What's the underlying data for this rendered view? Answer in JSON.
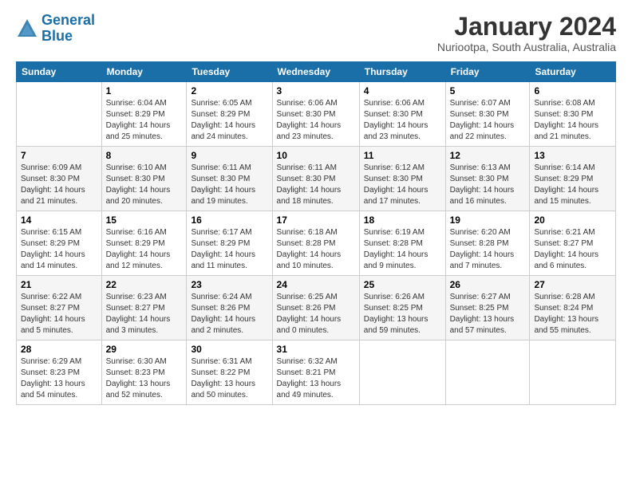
{
  "logo": {
    "line1": "General",
    "line2": "Blue"
  },
  "title": "January 2024",
  "subtitle": "Nuriootpa, South Australia, Australia",
  "days_header": [
    "Sunday",
    "Monday",
    "Tuesday",
    "Wednesday",
    "Thursday",
    "Friday",
    "Saturday"
  ],
  "weeks": [
    [
      {
        "num": "",
        "detail": ""
      },
      {
        "num": "1",
        "detail": "Sunrise: 6:04 AM\nSunset: 8:29 PM\nDaylight: 14 hours\nand 25 minutes."
      },
      {
        "num": "2",
        "detail": "Sunrise: 6:05 AM\nSunset: 8:29 PM\nDaylight: 14 hours\nand 24 minutes."
      },
      {
        "num": "3",
        "detail": "Sunrise: 6:06 AM\nSunset: 8:30 PM\nDaylight: 14 hours\nand 23 minutes."
      },
      {
        "num": "4",
        "detail": "Sunrise: 6:06 AM\nSunset: 8:30 PM\nDaylight: 14 hours\nand 23 minutes."
      },
      {
        "num": "5",
        "detail": "Sunrise: 6:07 AM\nSunset: 8:30 PM\nDaylight: 14 hours\nand 22 minutes."
      },
      {
        "num": "6",
        "detail": "Sunrise: 6:08 AM\nSunset: 8:30 PM\nDaylight: 14 hours\nand 21 minutes."
      }
    ],
    [
      {
        "num": "7",
        "detail": "Sunrise: 6:09 AM\nSunset: 8:30 PM\nDaylight: 14 hours\nand 21 minutes."
      },
      {
        "num": "8",
        "detail": "Sunrise: 6:10 AM\nSunset: 8:30 PM\nDaylight: 14 hours\nand 20 minutes."
      },
      {
        "num": "9",
        "detail": "Sunrise: 6:11 AM\nSunset: 8:30 PM\nDaylight: 14 hours\nand 19 minutes."
      },
      {
        "num": "10",
        "detail": "Sunrise: 6:11 AM\nSunset: 8:30 PM\nDaylight: 14 hours\nand 18 minutes."
      },
      {
        "num": "11",
        "detail": "Sunrise: 6:12 AM\nSunset: 8:30 PM\nDaylight: 14 hours\nand 17 minutes."
      },
      {
        "num": "12",
        "detail": "Sunrise: 6:13 AM\nSunset: 8:30 PM\nDaylight: 14 hours\nand 16 minutes."
      },
      {
        "num": "13",
        "detail": "Sunrise: 6:14 AM\nSunset: 8:29 PM\nDaylight: 14 hours\nand 15 minutes."
      }
    ],
    [
      {
        "num": "14",
        "detail": "Sunrise: 6:15 AM\nSunset: 8:29 PM\nDaylight: 14 hours\nand 14 minutes."
      },
      {
        "num": "15",
        "detail": "Sunrise: 6:16 AM\nSunset: 8:29 PM\nDaylight: 14 hours\nand 12 minutes."
      },
      {
        "num": "16",
        "detail": "Sunrise: 6:17 AM\nSunset: 8:29 PM\nDaylight: 14 hours\nand 11 minutes."
      },
      {
        "num": "17",
        "detail": "Sunrise: 6:18 AM\nSunset: 8:28 PM\nDaylight: 14 hours\nand 10 minutes."
      },
      {
        "num": "18",
        "detail": "Sunrise: 6:19 AM\nSunset: 8:28 PM\nDaylight: 14 hours\nand 9 minutes."
      },
      {
        "num": "19",
        "detail": "Sunrise: 6:20 AM\nSunset: 8:28 PM\nDaylight: 14 hours\nand 7 minutes."
      },
      {
        "num": "20",
        "detail": "Sunrise: 6:21 AM\nSunset: 8:27 PM\nDaylight: 14 hours\nand 6 minutes."
      }
    ],
    [
      {
        "num": "21",
        "detail": "Sunrise: 6:22 AM\nSunset: 8:27 PM\nDaylight: 14 hours\nand 5 minutes."
      },
      {
        "num": "22",
        "detail": "Sunrise: 6:23 AM\nSunset: 8:27 PM\nDaylight: 14 hours\nand 3 minutes."
      },
      {
        "num": "23",
        "detail": "Sunrise: 6:24 AM\nSunset: 8:26 PM\nDaylight: 14 hours\nand 2 minutes."
      },
      {
        "num": "24",
        "detail": "Sunrise: 6:25 AM\nSunset: 8:26 PM\nDaylight: 14 hours\nand 0 minutes."
      },
      {
        "num": "25",
        "detail": "Sunrise: 6:26 AM\nSunset: 8:25 PM\nDaylight: 13 hours\nand 59 minutes."
      },
      {
        "num": "26",
        "detail": "Sunrise: 6:27 AM\nSunset: 8:25 PM\nDaylight: 13 hours\nand 57 minutes."
      },
      {
        "num": "27",
        "detail": "Sunrise: 6:28 AM\nSunset: 8:24 PM\nDaylight: 13 hours\nand 55 minutes."
      }
    ],
    [
      {
        "num": "28",
        "detail": "Sunrise: 6:29 AM\nSunset: 8:23 PM\nDaylight: 13 hours\nand 54 minutes."
      },
      {
        "num": "29",
        "detail": "Sunrise: 6:30 AM\nSunset: 8:23 PM\nDaylight: 13 hours\nand 52 minutes."
      },
      {
        "num": "30",
        "detail": "Sunrise: 6:31 AM\nSunset: 8:22 PM\nDaylight: 13 hours\nand 50 minutes."
      },
      {
        "num": "31",
        "detail": "Sunrise: 6:32 AM\nSunset: 8:21 PM\nDaylight: 13 hours\nand 49 minutes."
      },
      {
        "num": "",
        "detail": ""
      },
      {
        "num": "",
        "detail": ""
      },
      {
        "num": "",
        "detail": ""
      }
    ]
  ]
}
